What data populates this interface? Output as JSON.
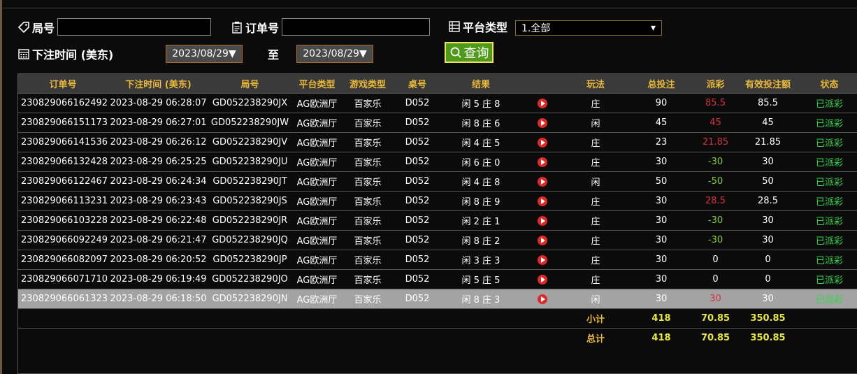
{
  "filters": {
    "round_label": "局号",
    "order_label": "订单号",
    "platform_label": "平台类型",
    "platform_value": "1.全部",
    "bet_time_label": "下注时间 (美东)",
    "date_from": "2023/08/29",
    "to_label": "至",
    "date_to": "2023/08/29",
    "query_label": "查询"
  },
  "table": {
    "headers": [
      "订单号",
      "下注时间 (美东)",
      "局号",
      "平台类型",
      "游戏类型",
      "桌号",
      "结果",
      "",
      "玩法",
      "总投注",
      "派彩",
      "有效投注额",
      "状态"
    ],
    "rows": [
      {
        "order": "230829066162492",
        "time": "2023-08-29 06:28:07",
        "round": "GD052238290JX",
        "platform": "AG欧洲厅",
        "game": "百家乐",
        "table": "D052",
        "result": "闲 5 庄 8",
        "play": "庄",
        "bet": "90",
        "payout": "85.5",
        "payout_color": "red",
        "valid": "85.5",
        "status": "已派彩"
      },
      {
        "order": "230829066151173",
        "time": "2023-08-29 06:27:01",
        "round": "GD052238290JW",
        "platform": "AG欧洲厅",
        "game": "百家乐",
        "table": "D052",
        "result": "闲 8 庄 6",
        "play": "闲",
        "bet": "45",
        "payout": "45",
        "payout_color": "red",
        "valid": "45",
        "status": "已派彩"
      },
      {
        "order": "230829066141536",
        "time": "2023-08-29 06:26:12",
        "round": "GD052238290JV",
        "platform": "AG欧洲厅",
        "game": "百家乐",
        "table": "D052",
        "result": "闲 4 庄 5",
        "play": "庄",
        "bet": "23",
        "payout": "21.85",
        "payout_color": "red",
        "valid": "21.85",
        "status": "已派彩"
      },
      {
        "order": "230829066132428",
        "time": "2023-08-29 06:25:25",
        "round": "GD052238290JU",
        "platform": "AG欧洲厅",
        "game": "百家乐",
        "table": "D052",
        "result": "闲 6 庄 0",
        "play": "庄",
        "bet": "30",
        "payout": "-30",
        "payout_color": "green",
        "valid": "30",
        "status": "已派彩"
      },
      {
        "order": "230829066122467",
        "time": "2023-08-29 06:24:34",
        "round": "GD052238290JT",
        "platform": "AG欧洲厅",
        "game": "百家乐",
        "table": "D052",
        "result": "闲 4 庄 8",
        "play": "闲",
        "bet": "50",
        "payout": "-50",
        "payout_color": "green",
        "valid": "50",
        "status": "已派彩"
      },
      {
        "order": "230829066113231",
        "time": "2023-08-29 06:23:43",
        "round": "GD052238290JS",
        "platform": "AG欧洲厅",
        "game": "百家乐",
        "table": "D052",
        "result": "闲 8 庄 9",
        "play": "庄",
        "bet": "30",
        "payout": "28.5",
        "payout_color": "red",
        "valid": "28.5",
        "status": "已派彩"
      },
      {
        "order": "230829066103228",
        "time": "2023-08-29 06:22:48",
        "round": "GD052238290JR",
        "platform": "AG欧洲厅",
        "game": "百家乐",
        "table": "D052",
        "result": "闲 2 庄 1",
        "play": "庄",
        "bet": "30",
        "payout": "-30",
        "payout_color": "green",
        "valid": "30",
        "status": "已派彩"
      },
      {
        "order": "230829066092249",
        "time": "2023-08-29 06:21:47",
        "round": "GD052238290JQ",
        "platform": "AG欧洲厅",
        "game": "百家乐",
        "table": "D052",
        "result": "闲 8 庄 2",
        "play": "庄",
        "bet": "30",
        "payout": "-30",
        "payout_color": "green",
        "valid": "30",
        "status": "已派彩"
      },
      {
        "order": "230829066082097",
        "time": "2023-08-29 06:20:52",
        "round": "GD052238290JP",
        "platform": "AG欧洲厅",
        "game": "百家乐",
        "table": "D052",
        "result": "闲 3 庄 3",
        "play": "庄",
        "bet": "30",
        "payout": "0",
        "payout_color": "white",
        "valid": "0",
        "status": "已派彩"
      },
      {
        "order": "230829066071710",
        "time": "2023-08-29 06:19:49",
        "round": "GD052238290JO",
        "platform": "AG欧洲厅",
        "game": "百家乐",
        "table": "D052",
        "result": "闲 5 庄 5",
        "play": "庄",
        "bet": "30",
        "payout": "0",
        "payout_color": "white",
        "valid": "0",
        "status": "已派彩"
      },
      {
        "order": "230829066061323",
        "time": "2023-08-29 06:18:50",
        "round": "GD052238290JN",
        "platform": "AG欧洲厅",
        "game": "百家乐",
        "table": "D052",
        "result": "闲 8 庄 3",
        "play": "闲",
        "bet": "30",
        "payout": "30",
        "payout_color": "red",
        "valid": "30",
        "status": "已派彩"
      }
    ],
    "selected_row": 10,
    "subtotal": {
      "label": "小计",
      "bet": "418",
      "payout": "70.85",
      "valid": "350.85"
    },
    "total": {
      "label": "总计",
      "bet": "418",
      "payout": "70.85",
      "valid": "350.85"
    }
  },
  "colors": {
    "header_text": "#e8b838",
    "status": "#2fd84a",
    "loss": "#7ed030",
    "win": "#d43040",
    "query_button": "#4f9a1a"
  },
  "icons": {
    "round": "tag-icon",
    "order": "clipboard-icon",
    "platform": "list-icon",
    "time": "calendar-icon",
    "query": "search-icon",
    "row_action": "play-icon",
    "dropdown": "chevron-down-icon"
  }
}
